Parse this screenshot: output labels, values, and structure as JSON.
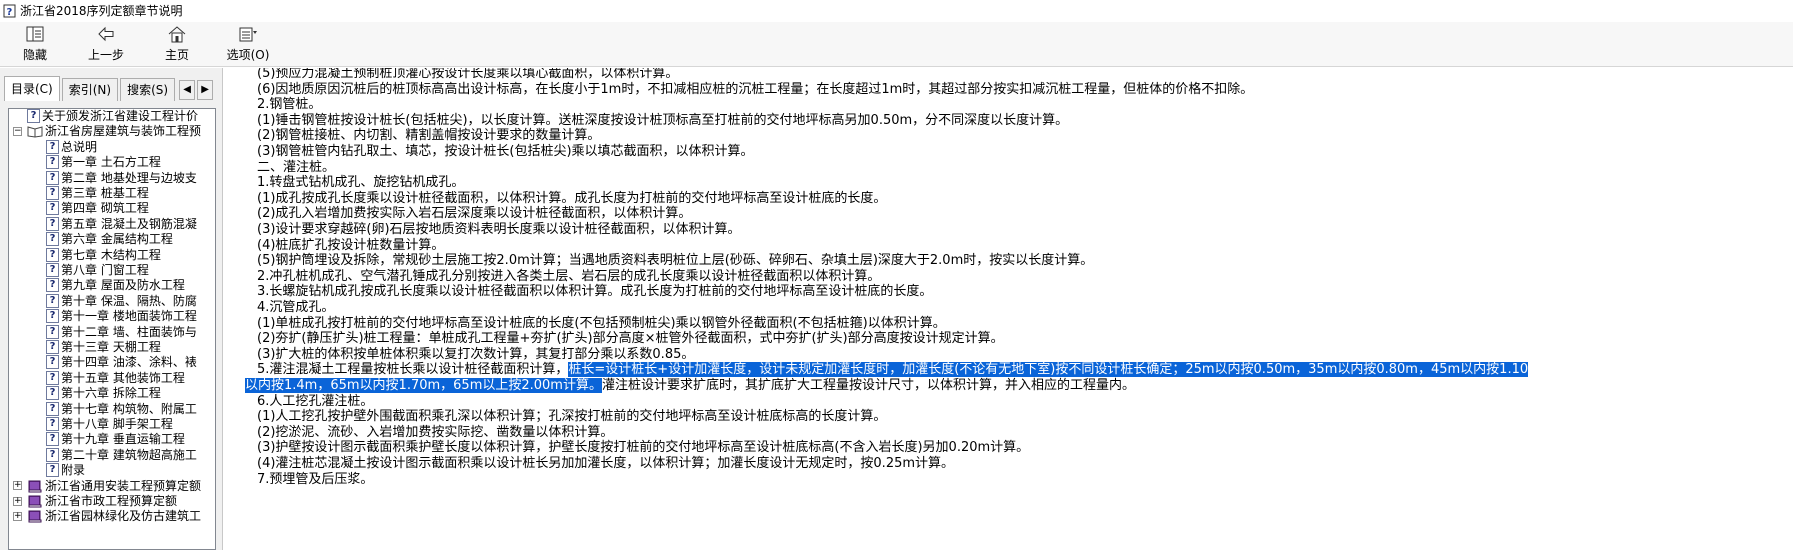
{
  "window": {
    "title": "浙江省2018序列定额章节说明"
  },
  "toolbar": {
    "hide_label": "隐藏",
    "back_label": "上一步",
    "home_label": "主页",
    "options_label": "选项(O)"
  },
  "tabs": {
    "contents": "目录(C)",
    "index": "索引(N)",
    "search": "搜索(S)",
    "prev": "◀",
    "next": "▶"
  },
  "tree": [
    {
      "label": "关于颁发浙江省建设工程计价",
      "icon": "question-page-icon",
      "expander": ""
    },
    {
      "label": "浙江省房屋建筑与装饰工程预",
      "icon": "open-book-icon",
      "expander": "−"
    },
    {
      "label": "总说明",
      "icon": "question-page-icon",
      "expander": ""
    },
    {
      "label": "第一章  土石方工程",
      "icon": "question-page-icon",
      "expander": ""
    },
    {
      "label": "第二章  地基处理与边坡支",
      "icon": "question-page-icon",
      "expander": ""
    },
    {
      "label": "第三章  桩基工程",
      "icon": "question-page-icon",
      "expander": ""
    },
    {
      "label": "第四章  砌筑工程",
      "icon": "question-page-icon",
      "expander": ""
    },
    {
      "label": "第五章  混凝土及钢筋混凝",
      "icon": "question-page-icon",
      "expander": ""
    },
    {
      "label": "第六章  金属结构工程",
      "icon": "question-page-icon",
      "expander": ""
    },
    {
      "label": "第七章  木结构工程",
      "icon": "question-page-icon",
      "expander": ""
    },
    {
      "label": "第八章  门窗工程",
      "icon": "question-page-icon",
      "expander": ""
    },
    {
      "label": "第九章  屋面及防水工程",
      "icon": "question-page-icon",
      "expander": ""
    },
    {
      "label": "第十章  保温、隔热、防腐",
      "icon": "question-page-icon",
      "expander": ""
    },
    {
      "label": "第十一章  楼地面装饰工程",
      "icon": "question-page-icon",
      "expander": ""
    },
    {
      "label": "第十二章  墙、柱面装饰与",
      "icon": "question-page-icon",
      "expander": ""
    },
    {
      "label": "第十三章  天棚工程",
      "icon": "question-page-icon",
      "expander": ""
    },
    {
      "label": "第十四章  油漆、涂料、裱",
      "icon": "question-page-icon",
      "expander": ""
    },
    {
      "label": "第十五章  其他装饰工程",
      "icon": "question-page-icon",
      "expander": ""
    },
    {
      "label": "第十六章  拆除工程",
      "icon": "question-page-icon",
      "expander": ""
    },
    {
      "label": "第十七章  构筑物、附属工",
      "icon": "question-page-icon",
      "expander": ""
    },
    {
      "label": "第十八章  脚手架工程",
      "icon": "question-page-icon",
      "expander": ""
    },
    {
      "label": "第十九章  垂直运输工程",
      "icon": "question-page-icon",
      "expander": ""
    },
    {
      "label": "第二十章  建筑物超高施工",
      "icon": "question-page-icon",
      "expander": ""
    },
    {
      "label": "附录",
      "icon": "question-page-icon",
      "expander": ""
    },
    {
      "label": "浙江省通用安装工程预算定额",
      "icon": "closed-book-icon",
      "expander": "+"
    },
    {
      "label": "浙江省市政工程预算定额",
      "icon": "closed-book-icon",
      "expander": "+"
    },
    {
      "label": "浙江省园林绿化及仿古建筑工",
      "icon": "closed-book-icon",
      "expander": "+"
    }
  ],
  "content": {
    "lines": [
      {
        "indent": 1,
        "text": "(5)预应力混凝土预制桩顶灌心按设计长度乘以填心截面积，以体积计算。"
      },
      {
        "indent": 1,
        "text": "(6)因地质原因沉桩后的桩顶标高高出设计标高，在长度小于1m时，不扣减相应桩的沉桩工程量；在长度超过1m时，其超过部分按实扣减沉桩工程量，但桩体的价格不扣除。"
      },
      {
        "indent": 1,
        "text": "2.钢管桩。"
      },
      {
        "indent": 1,
        "text": "(1)锤击钢管桩按设计桩长(包括桩尖)，以长度计算。送桩深度按设计桩顶标高至打桩前的交付地坪标高另加0.50m，分不同深度以长度计算。"
      },
      {
        "indent": 1,
        "text": "(2)钢管桩接桩、内切割、精割盖帽按设计要求的数量计算。"
      },
      {
        "indent": 1,
        "text": "(3)钢管桩管内钻孔取土、填芯，按设计桩长(包括桩尖)乘以填芯截面积，以体积计算。"
      },
      {
        "indent": 1,
        "text": "二、灌注桩。"
      },
      {
        "indent": 1,
        "text": "1.转盘式钻机成孔、旋挖钻机成孔。"
      },
      {
        "indent": 1,
        "text": "(1)成孔按成孔长度乘以设计桩径截面积，以体积计算。成孔长度为打桩前的交付地坪标高至设计桩底的长度。"
      },
      {
        "indent": 1,
        "text": "(2)成孔入岩增加费按实际入岩石层深度乘以设计桩径截面积，以体积计算。"
      },
      {
        "indent": 1,
        "text": "(3)设计要求穿越碎(卵)石层按地质资料表明长度乘以设计桩径截面积，以体积计算。"
      },
      {
        "indent": 1,
        "text": "(4)桩底扩孔按设计桩数量计算。"
      },
      {
        "indent": 1,
        "text": "(5)钢护筒埋设及拆除，常规砂土层施工按2.0m计算；当遇地质资料表明桩位上层(砂砾、碎卵石、杂填土层)深度大于2.0m时，按实以长度计算。"
      },
      {
        "indent": 1,
        "text": "2.冲孔桩机成孔、空气潜孔锤成孔分别按进入各类土层、岩石层的成孔长度乘以设计桩径截面积以体积计算。"
      },
      {
        "indent": 1,
        "text": "3.长螺旋钻机成孔按成孔长度乘以设计桩径截面积以体积计算。成孔长度为打桩前的交付地坪标高至设计桩底的长度。"
      },
      {
        "indent": 1,
        "text": "4.沉管成孔。"
      },
      {
        "indent": 1,
        "text": "(1)单桩成孔按打桩前的交付地坪标高至设计桩底的长度(不包括预制桩尖)乘以钢管外径截面积(不包括桩箍)以体积计算。"
      },
      {
        "indent": 1,
        "text": "(2)夯扩(静压扩头)桩工程量：单桩成孔工程量+夯扩(扩头)部分高度×桩管外径截面积，式中夯扩(扩头)部分高度按设计规定计算。"
      },
      {
        "indent": 1,
        "text": "(3)扩大桩的体积按单桩体积乘以复打次数计算，其复打部分乘以系数0.85。"
      },
      {
        "indent": 1,
        "text": "5.灌注混凝土工程量按桩长乘以设计桩径截面积计算，",
        "sel": "桩长=设计桩长+设计加灌长度，设计未规定加灌长度时，加灌长度(不论有无地下室)按不同设计桩长确定；25m以内按0.50m，35m以内按0.80m，45m以内按1.10"
      },
      {
        "indent": 0,
        "sel": "以内按1.4m，65m以内按1.70m，65m以上按2.00m计算。",
        "text": "灌注桩设计要求扩底时，其扩底扩大工程量按设计尺寸，以体积计算，并入相应的工程量内。"
      },
      {
        "indent": 1,
        "text": "6.人工挖孔灌注桩。"
      },
      {
        "indent": 1,
        "text": "(1)人工挖孔按护壁外围截面积乘孔深以体积计算；孔深按打桩前的交付地坪标高至设计桩底标高的长度计算。"
      },
      {
        "indent": 1,
        "text": "(2)挖淤泥、流砂、入岩增加费按实际挖、凿数量以体积计算。"
      },
      {
        "indent": 1,
        "text": "(3)护壁按设计图示截面积乘护壁长度以体积计算，护壁长度按打桩前的交付地坪标高至设计桩底标高(不含入岩长度)另加0.20m计算。"
      },
      {
        "indent": 1,
        "text": "(4)灌注桩芯混凝土按设计图示截面积乘以设计桩长另加加灌长度，以体积计算；加灌长度设计无规定时，按0.25m计算。"
      },
      {
        "indent": 1,
        "text": "7.预埋管及后压浆。"
      }
    ]
  }
}
